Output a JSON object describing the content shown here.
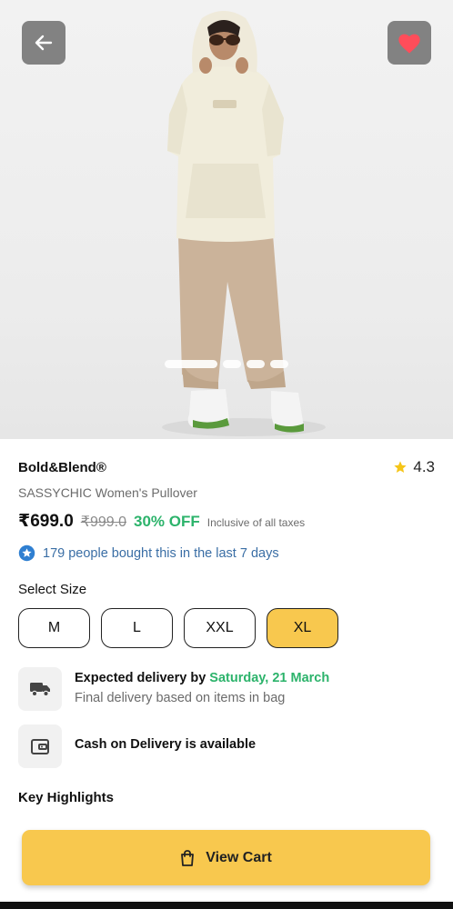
{
  "product": {
    "brand": "Bold&Blend®",
    "name": "SASSYCHIC Women's Pullover",
    "rating": "4.3",
    "price": "₹699.0",
    "mrp": "₹999.0",
    "discount": "30% OFF",
    "tax_note": "Inclusive of all taxes"
  },
  "social_proof": "179 people bought this in the last 7 days",
  "sizes": {
    "label": "Select Size",
    "options": [
      "M",
      "L",
      "XXL",
      "XL"
    ],
    "selected": "XL"
  },
  "delivery": {
    "title_prefix": "Expected delivery by",
    "date": "Saturday, 21 March",
    "subtitle": "Final delivery based on items in bag"
  },
  "cod": {
    "title": "Cash on Delivery is available"
  },
  "key_highlights": "Key Highlights",
  "cart_button": "View Cart",
  "carousel": {
    "count": 4,
    "active_index": 0
  },
  "colors": {
    "accent": "#f8c84e",
    "discount_green": "#2cb36b",
    "link_blue": "#3a6ea5",
    "heart_red": "#ff4d5a"
  }
}
